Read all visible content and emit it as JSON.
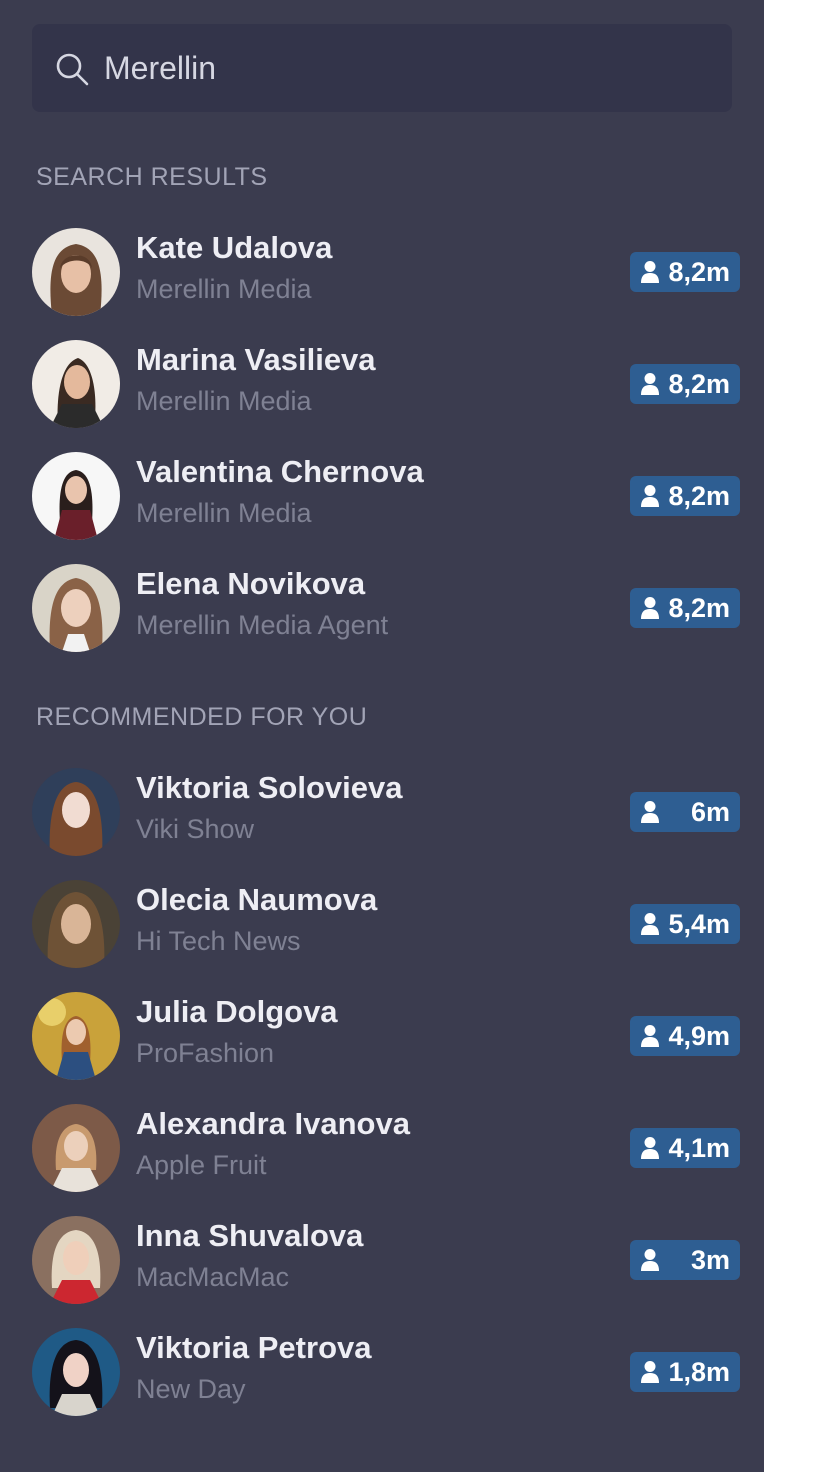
{
  "search": {
    "value": "Merellin"
  },
  "sections": {
    "search_results_title": "SEARCH RESULTS",
    "recommended_title": "RECOMMENDED FOR YOU"
  },
  "search_results": [
    {
      "name": "Kate Udalova",
      "subtitle": "Merellin Media",
      "followers": "8,2m"
    },
    {
      "name": "Marina Vasilieva",
      "subtitle": "Merellin Media",
      "followers": "8,2m"
    },
    {
      "name": "Valentina Chernova",
      "subtitle": "Merellin Media",
      "followers": "8,2m"
    },
    {
      "name": "Elena Novikova",
      "subtitle": "Merellin Media Agent",
      "followers": "8,2m"
    }
  ],
  "recommended": [
    {
      "name": "Viktoria Solovieva",
      "subtitle": "Viki Show",
      "followers": "6m"
    },
    {
      "name": "Olecia Naumova",
      "subtitle": "Hi Tech News",
      "followers": "5,4m"
    },
    {
      "name": "Julia Dolgova",
      "subtitle": "ProFashion",
      "followers": "4,9m"
    },
    {
      "name": "Alexandra Ivanova",
      "subtitle": "Apple Fruit",
      "followers": "4,1m"
    },
    {
      "name": "Inna Shuvalova",
      "subtitle": "MacMacMac",
      "followers": "3m"
    },
    {
      "name": "Viktoria Petrova",
      "subtitle": "New Day",
      "followers": "1,8m"
    }
  ],
  "icons": {
    "search": "search-icon",
    "followers": "user-icon"
  },
  "colors": {
    "panel_background": "#3b3c4f",
    "search_background": "#33344a",
    "badge": "#2e5e92",
    "name_text": "#eeeef4",
    "subtitle_text": "#7f8193",
    "section_title": "#a2a4b6"
  }
}
